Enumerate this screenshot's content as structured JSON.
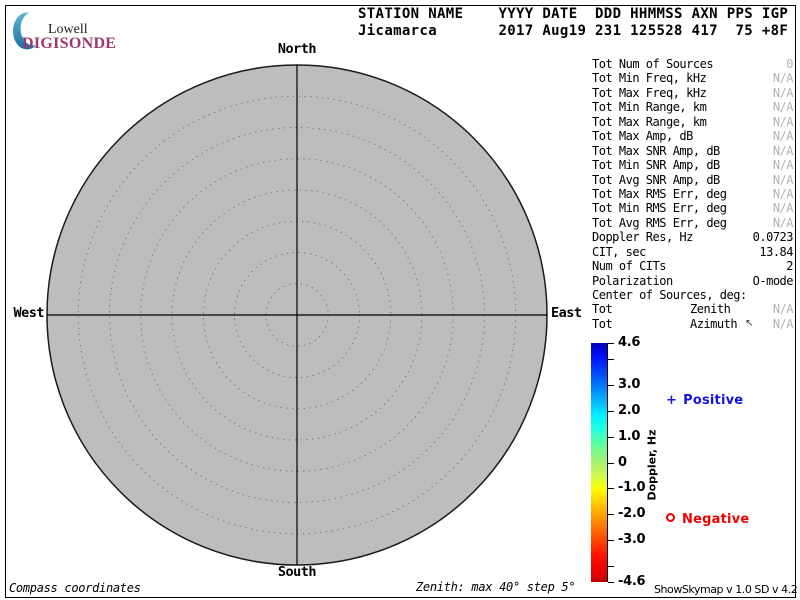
{
  "logo": {
    "lowell": "Lowell",
    "digisonde": "DIGISONDE"
  },
  "header": {
    "line1": "STATION NAME    YYYY DATE  DDD HHMMSS AXN PPS IGP",
    "line2": "Jicamarca       2017 Aug19 231 125528 417  75 +8F",
    "station": "Jicamarca",
    "year": "2017",
    "date": "Aug19",
    "ddd": "231",
    "hhmmss": "125528",
    "axn": "417",
    "pps": "75",
    "igp": "+8F"
  },
  "compass": {
    "north": "North",
    "south": "South",
    "west": "West",
    "east": "East"
  },
  "stats": {
    "rows": [
      {
        "label": "Tot Num of Sources",
        "value": "0",
        "na": true
      },
      {
        "label": "Tot Min Freq, kHz",
        "value": "N/A",
        "na": true
      },
      {
        "label": "Tot Max Freq, kHz",
        "value": "N/A",
        "na": true
      },
      {
        "label": "Tot Min Range, km",
        "value": "N/A",
        "na": true
      },
      {
        "label": "Tot Max Range, km",
        "value": "N/A",
        "na": true
      },
      {
        "label": "Tot Max Amp, dB",
        "value": "N/A",
        "na": true
      },
      {
        "label": "Tot Max SNR Amp, dB",
        "value": "N/A",
        "na": true
      },
      {
        "label": "Tot Min SNR Amp, dB",
        "value": "N/A",
        "na": true
      },
      {
        "label": "Tot Avg SNR Amp, dB",
        "value": "N/A",
        "na": true
      },
      {
        "label": "Tot Max RMS Err, deg",
        "value": "N/A",
        "na": true
      },
      {
        "label": "Tot Min RMS Err, deg",
        "value": "N/A",
        "na": true
      },
      {
        "label": "Tot Avg RMS Err, deg",
        "value": "N/A",
        "na": true
      },
      {
        "label": "Doppler Res, Hz",
        "value": "0.0723",
        "na": false
      },
      {
        "label": "CIT, sec",
        "value": "13.84",
        "na": false
      },
      {
        "label": "Num of CITs",
        "value": "2",
        "na": false
      },
      {
        "label": "Polarization",
        "value": "O-mode",
        "na": false
      },
      {
        "label": "Center of Sources, deg:",
        "value": "",
        "na": false
      },
      {
        "label": "Tot",
        "mid": "Zenith",
        "value": "N/A",
        "na": true
      },
      {
        "label": "Tot",
        "mid": "Azimuth",
        "value": "N/A",
        "na": true,
        "cursor": true
      }
    ]
  },
  "colorbar": {
    "axis_label": "Doppler, Hz",
    "max": 4.6,
    "min": -4.6,
    "ticks": [
      {
        "v": 4.6,
        "label": "4.6"
      },
      {
        "v": 4.0,
        "label": ""
      },
      {
        "v": 3.0,
        "label": "3.0"
      },
      {
        "v": 2.0,
        "label": "2.0"
      },
      {
        "v": 1.0,
        "label": "1.0"
      },
      {
        "v": 0,
        "label": "0"
      },
      {
        "v": -1.0,
        "label": "-1.0"
      },
      {
        "v": -2.0,
        "label": "-2.0"
      },
      {
        "v": -3.0,
        "label": "-3.0"
      },
      {
        "v": -4.0,
        "label": ""
      },
      {
        "v": -4.6,
        "label": "-4.6"
      }
    ],
    "gradient": [
      {
        "p": 0,
        "c": "#0000bb"
      },
      {
        "p": 6,
        "c": "#0010ff"
      },
      {
        "p": 15,
        "c": "#0060ff"
      },
      {
        "p": 24,
        "c": "#00b4ff"
      },
      {
        "p": 30,
        "c": "#00eeff"
      },
      {
        "p": 36,
        "c": "#22ffdd"
      },
      {
        "p": 43,
        "c": "#66ff99"
      },
      {
        "p": 50,
        "c": "#a8f06e"
      },
      {
        "p": 56,
        "c": "#d6f948"
      },
      {
        "p": 61,
        "c": "#ffff00"
      },
      {
        "p": 68,
        "c": "#ffc000"
      },
      {
        "p": 74,
        "c": "#ff9000"
      },
      {
        "p": 81,
        "c": "#ff5500"
      },
      {
        "p": 89,
        "c": "#ff1100"
      },
      {
        "p": 95,
        "c": "#ee0000"
      },
      {
        "p": 100,
        "c": "#c00000"
      }
    ]
  },
  "legend": {
    "positive_label": "Positive",
    "negative_label": "Negative",
    "positive_color": "#1414dd",
    "negative_color": "#ee0000"
  },
  "footer": {
    "left": "Compass coordinates",
    "center": "Zenith: max 40°  step 5°",
    "right": "ShowSkymap v 1.0  SD v 4.2"
  },
  "chart_data": {
    "type": "scatter",
    "projection": "polar-skymap",
    "title": "DIGISONDE skymap, Jicamarca, 2017 Aug19 day 231, 12:55:28",
    "zenith_max_deg": 40,
    "zenith_step_deg": 5,
    "compass_labels": [
      "North",
      "East",
      "South",
      "West"
    ],
    "coordinates": "Compass coordinates",
    "num_sources": 0,
    "points": [],
    "colorbar": {
      "label": "Doppler, Hz",
      "range": [
        -4.6,
        4.6
      ],
      "labeled_ticks": [
        4.6,
        3.0,
        2.0,
        1.0,
        0,
        -1.0,
        -2.0,
        -3.0,
        -4.6
      ],
      "unlabeled_ticks": [
        4.0,
        -4.0
      ]
    },
    "legend": [
      {
        "marker": "+",
        "label": "Positive",
        "color": "#1414dd"
      },
      {
        "marker": "o",
        "label": "Negative",
        "color": "#ee0000"
      }
    ],
    "plot_style": {
      "fill": "#bdbdbd",
      "grid": "dotted concentric circles every 5 deg with N-S and E-W crosshair"
    }
  }
}
